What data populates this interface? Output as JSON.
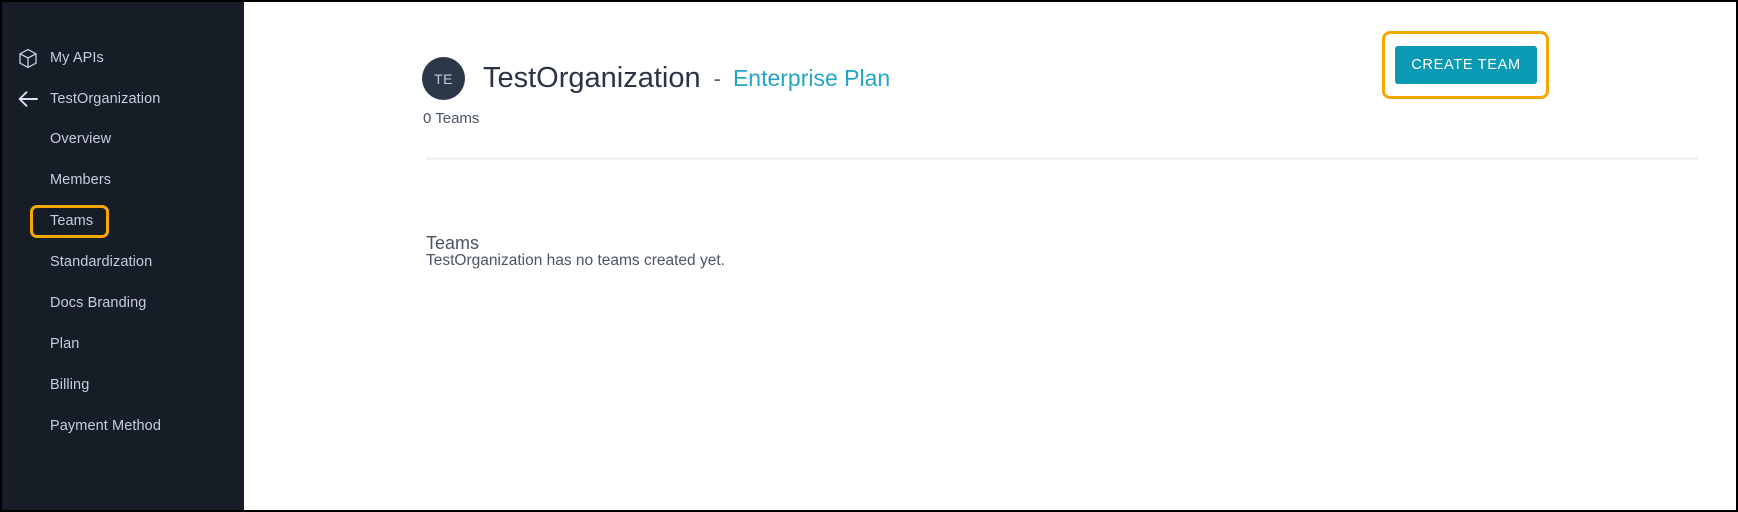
{
  "theme": {
    "sidebar_bg": "#161d26",
    "sidebar_text": "#c3cede",
    "highlight_color": "#f5a800",
    "accent_teal": "#0b9ab4",
    "plan_link_color": "#23a5c6",
    "avatar_bg": "#2c3749",
    "divider_color": "#f2f3f5",
    "page_bg": "#ffffff"
  },
  "sidebar": {
    "top_items": [
      {
        "label": "My APIs",
        "icon": "cube-icon"
      },
      {
        "label": "TestOrganization",
        "icon": "arrow-left-icon"
      }
    ],
    "sub_items": [
      {
        "label": "Overview",
        "selected": false
      },
      {
        "label": "Members",
        "selected": false
      },
      {
        "label": "Teams",
        "selected": true
      },
      {
        "label": "Standardization",
        "selected": false
      },
      {
        "label": "Docs Branding",
        "selected": false
      },
      {
        "label": "Plan",
        "selected": false
      },
      {
        "label": "Billing",
        "selected": false
      },
      {
        "label": "Payment Method",
        "selected": false
      }
    ]
  },
  "header": {
    "avatar_initials": "TE",
    "org_name": "TestOrganization",
    "separator": "-",
    "plan_label": "Enterprise Plan",
    "create_team_label": "CREATE TEAM"
  },
  "main": {
    "team_count": "0 Teams",
    "section_heading": "Teams",
    "empty_message": "TestOrganization has no teams created yet."
  }
}
